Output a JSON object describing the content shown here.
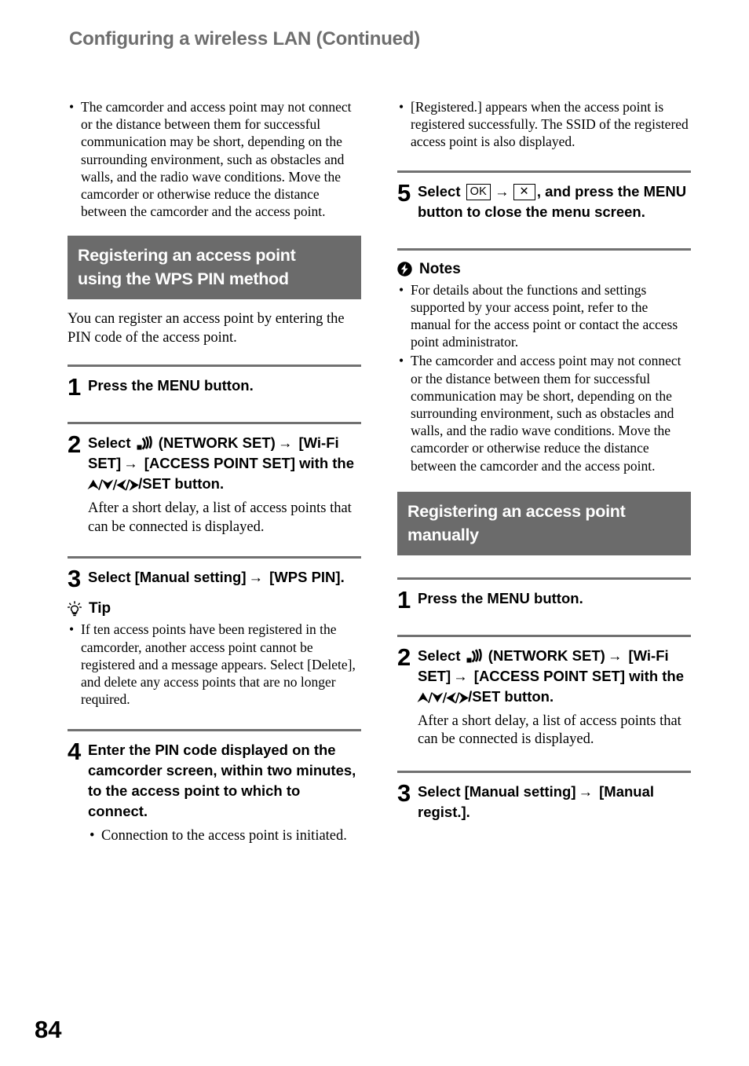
{
  "page": {
    "running_head": "Configuring a wireless LAN (Continued)",
    "folio": "84",
    "heading_bar_color": "#6b6b6b",
    "heading_text_color": "#ffffff",
    "running_head_color": "#6e6e6e",
    "rule_color": "#717171"
  },
  "left_column": {
    "intro_bullets": [
      "The camcorder and access point may not connect or the distance between them for successful communication may be short, depending on the surrounding environment, such as obstacles and walls, and the radio wave conditions. Move the camcorder or otherwise reduce the distance between the camcorder and the access point."
    ],
    "section": {
      "heading_line1": "Registering an access point",
      "heading_line2": "using the WPS PIN method",
      "intro": "You can register an access point by entering the PIN code of the access point."
    },
    "steps": [
      {
        "number": "1",
        "title": "Press the MENU button."
      },
      {
        "number": "2",
        "title_part1": "Select",
        "icon": "network-icon",
        "title_part2": "(NETWORK SET)",
        "arrow1": "→",
        "title_part3": "[Wi-Fi SET]",
        "arrow2": "→",
        "title_part4": "[ACCESS POINT SET] with the",
        "dpad": "⮝/⮟/⮜/⮞",
        "title_part5": "/SET button.",
        "note": "After a short delay, a list of access points that can be connected is displayed."
      },
      {
        "number": "3",
        "title_part1": "Select [Manual setting]",
        "arrow1": "→",
        "title_part2": "[WPS PIN]."
      },
      {
        "number": "4",
        "title": "Enter the PIN code displayed on the camcorder screen, within two minutes, to the access point to which to connect.",
        "subbullet": "Connection to the access point is initiated."
      }
    ],
    "tip": {
      "icon": "lightbulb-icon",
      "label": "Tip",
      "bullets": [
        "If ten access points have been registered in the camcorder, another access point cannot be registered and a message appears. Select [Delete], and delete any access points that are no longer required."
      ]
    }
  },
  "right_column": {
    "intro_bullets": [
      "[Registered.] appears when the access point is registered successfully. The SSID of the registered access point is also displayed."
    ],
    "step5": {
      "number": "5",
      "title_part1": "Select",
      "key_ok": "OK",
      "arrow1": "→",
      "key_x": "✕",
      "title_part2": ", and press the MENU button to close the menu screen."
    },
    "notes": {
      "icon": "note-lightning-icon",
      "label": "Notes",
      "bullets": [
        "For details about the functions and settings supported by your access point, refer to the manual for the access point or contact the access point administrator.",
        "The camcorder and access point may not connect or the distance between them for successful communication may be short, depending on the surrounding environment, such as obstacles and walls, and the radio wave conditions. Move the camcorder or otherwise reduce the distance between the camcorder and the access point."
      ]
    },
    "section": {
      "heading_line1": "Registering an access point",
      "heading_line2": "manually"
    },
    "steps": [
      {
        "number": "1",
        "title": "Press the MENU button."
      },
      {
        "number": "2",
        "title_part1": "Select",
        "icon": "network-icon",
        "title_part2": "(NETWORK SET)",
        "arrow1": "→",
        "title_part3": "[Wi-Fi SET]",
        "arrow2": "→",
        "title_part4": "[ACCESS POINT SET] with the",
        "dpad": "⮝/⮟/⮜/⮞",
        "title_part5": "/SET button.",
        "note": "After a short delay, a list of access points that can be connected is displayed."
      },
      {
        "number": "3",
        "title_part1": "Select [Manual setting]",
        "arrow1": "→",
        "title_part2": "[Manual regist.]."
      }
    ]
  }
}
